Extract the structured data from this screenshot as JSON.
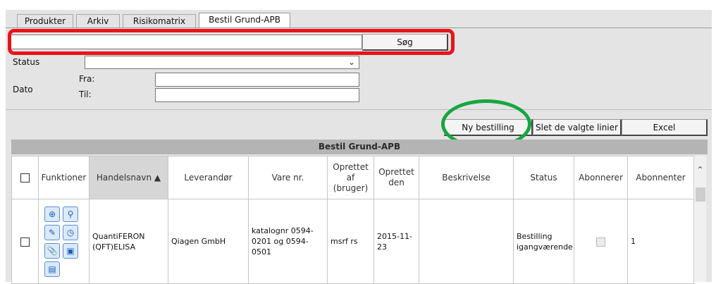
{
  "tabs": [
    {
      "label": "Produkter"
    },
    {
      "label": "Arkiv"
    },
    {
      "label": "Risikomatrix"
    },
    {
      "label": "Bestil Grund-APB",
      "active": true
    }
  ],
  "search": {
    "value": "",
    "button_label": "Søg"
  },
  "filters": {
    "status_label": "Status",
    "status_value": "",
    "date_label": "Dato",
    "from_label": "Fra:",
    "to_label": "Til:"
  },
  "actions": {
    "new_order": "Ny bestilling",
    "delete_selected": "Slet de valgte linier",
    "excel": "Excel"
  },
  "grid": {
    "title": "Bestil Grund-APB",
    "columns": [
      "Funktioner",
      "Handelsnavn ▲",
      "Leverandør",
      "Vare nr.",
      "Oprettet af (bruger)",
      "Oprettet den",
      "Beskrivelse",
      "Status",
      "Abonnerer",
      "Abonnenter"
    ],
    "rows": [
      {
        "tradename": "QuantiFERON (QFT)ELISA",
        "supplier": "Qiagen GmbH",
        "item_no": "katalognr 0594-0201 og 0594-0501",
        "created_by": "msrf rs",
        "created_on": "2015-11-23",
        "description": "",
        "status": "Bestilling igangværende",
        "subscribers": "1"
      }
    ]
  },
  "colors": {
    "highlight_red": "#e8141b",
    "highlight_green": "#16a640",
    "header_bar": "#b4b4b4"
  },
  "icons": [
    "zoom-in-icon",
    "search-icon",
    "edit-icon",
    "history-icon",
    "attachment-icon",
    "card-icon",
    "document-edit-icon",
    "chevron-up-icon",
    "chevron-down-icon"
  ]
}
